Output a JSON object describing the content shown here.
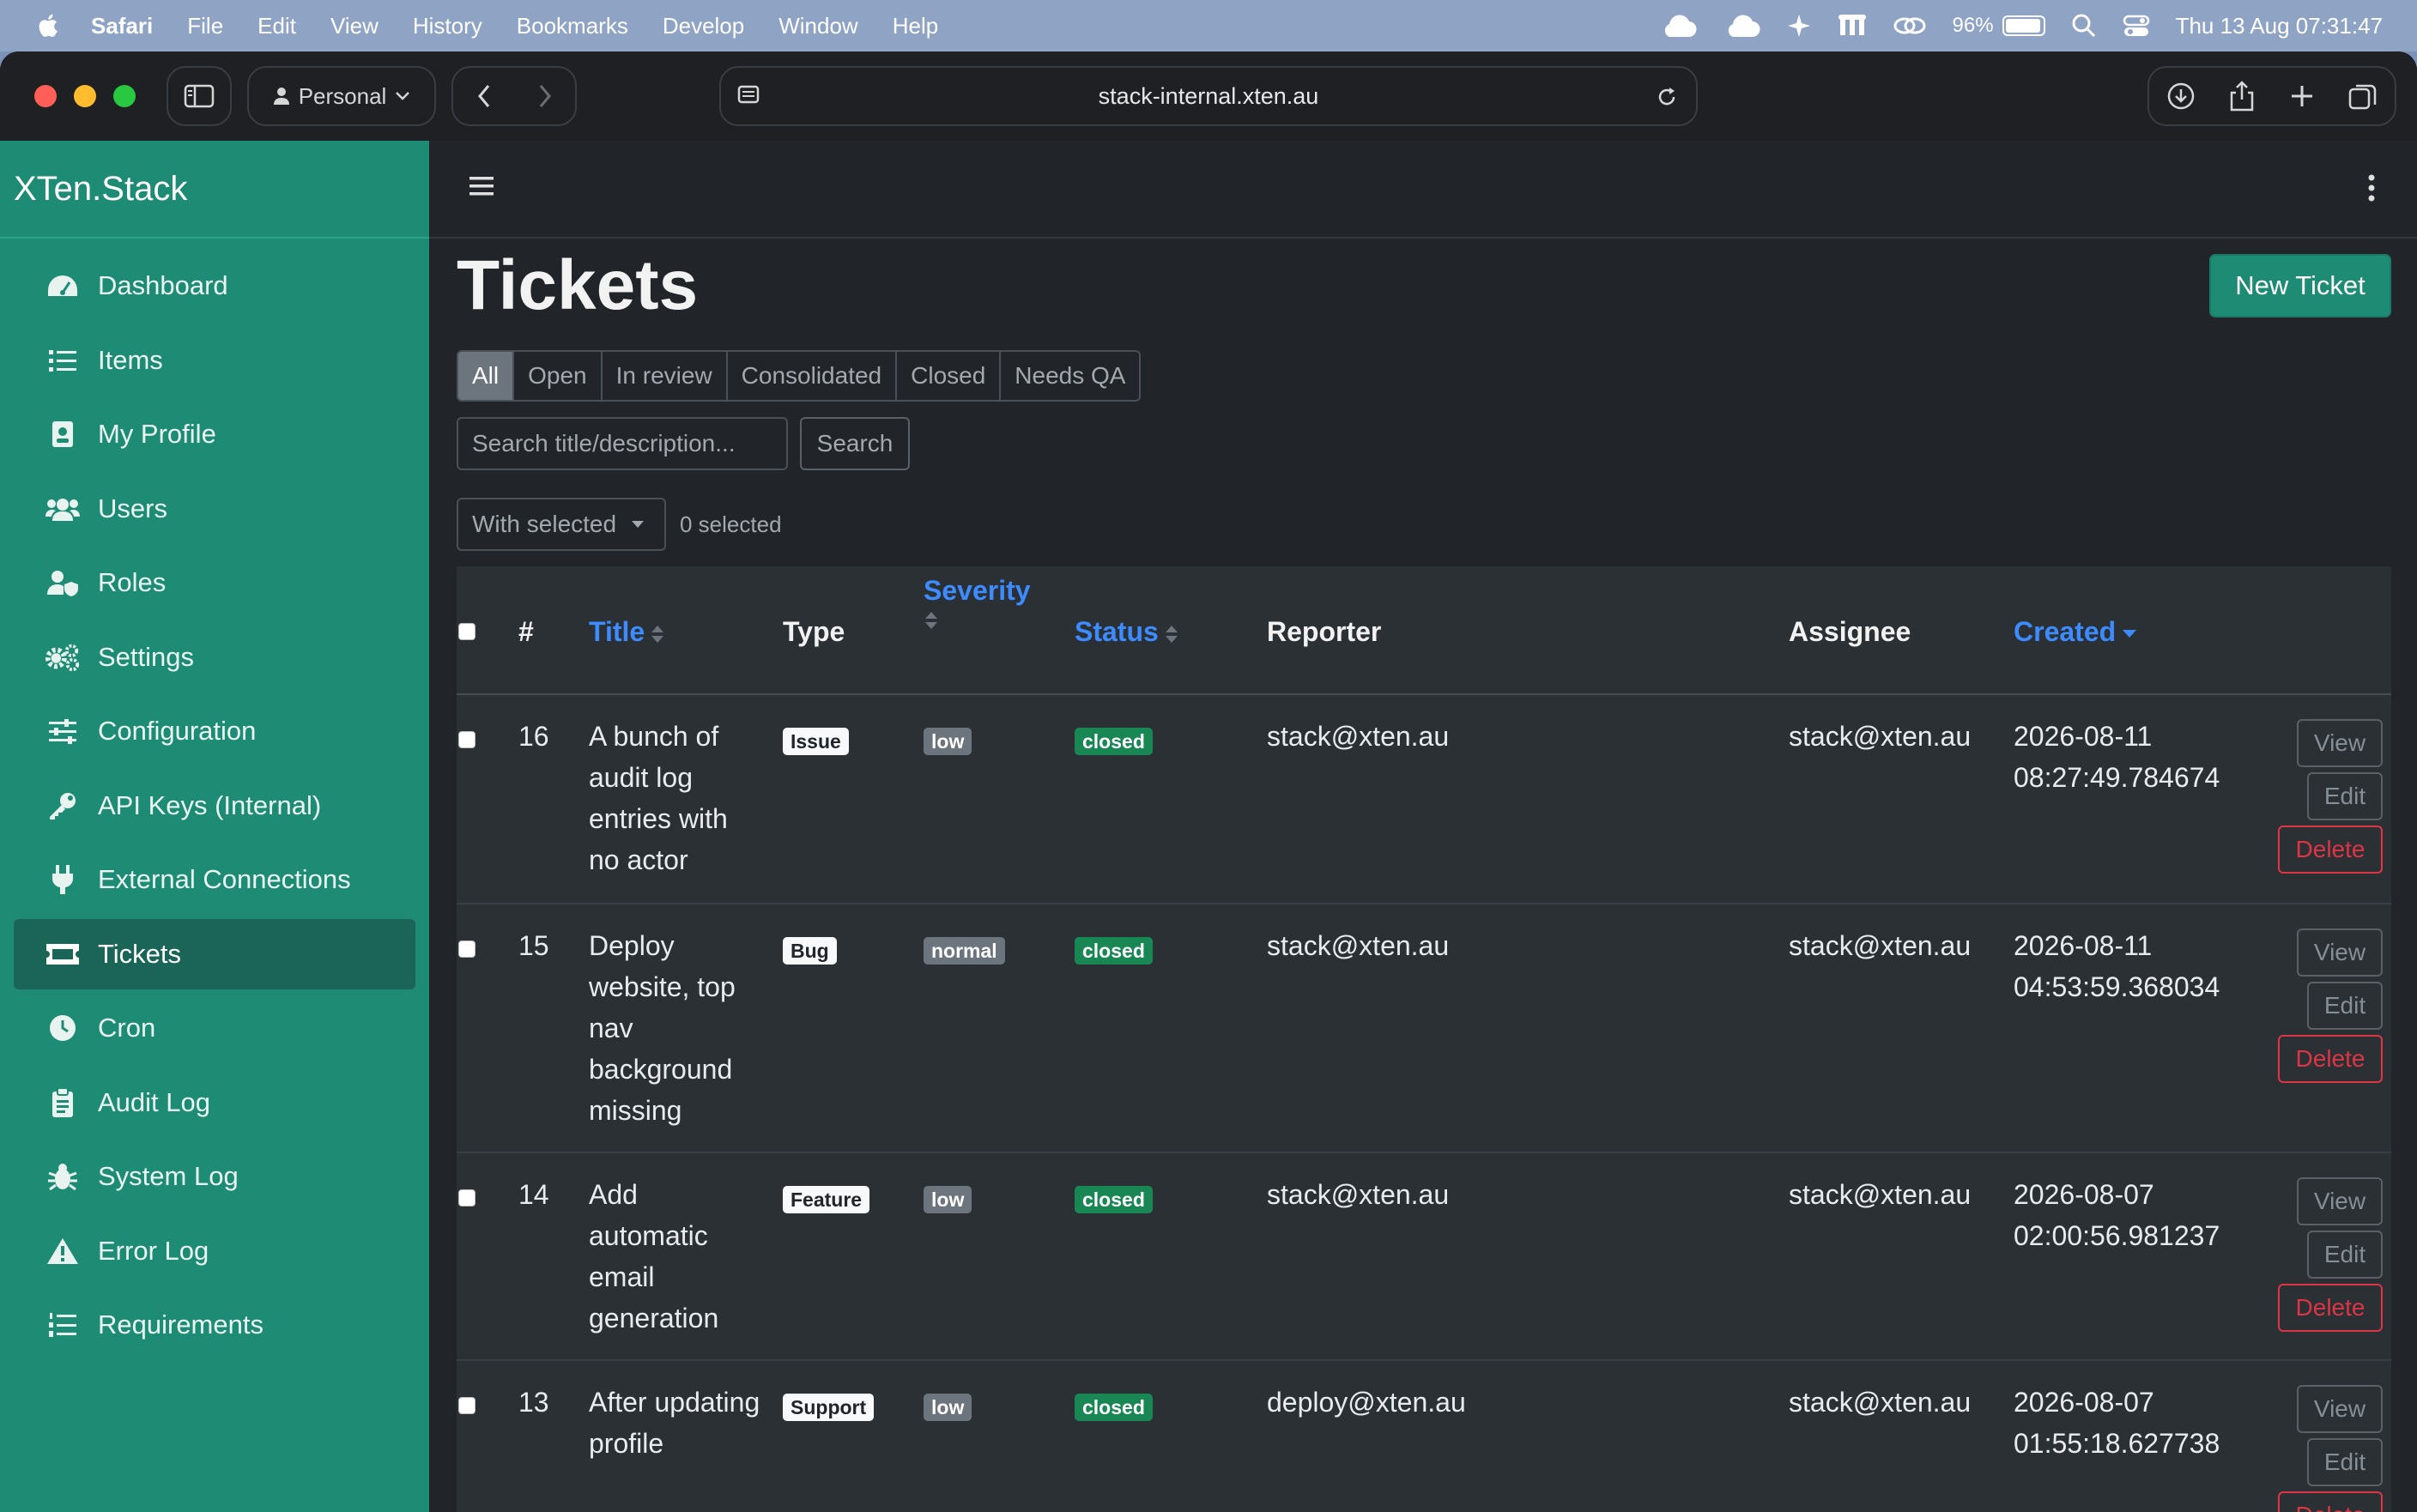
{
  "menubar": {
    "app_name": "Safari",
    "menus": [
      "File",
      "Edit",
      "View",
      "History",
      "Bookmarks",
      "Develop",
      "Window",
      "Help"
    ],
    "battery": "96%",
    "datetime": "Thu 13 Aug  07:31:47"
  },
  "browser": {
    "profile": "Personal",
    "url": "stack-internal.xten.au"
  },
  "sidebar": {
    "brand": "XTen.Stack",
    "items": [
      {
        "label": "Dashboard",
        "icon": "dashboard-icon"
      },
      {
        "label": "Items",
        "icon": "list-icon"
      },
      {
        "label": "My Profile",
        "icon": "id-badge-icon"
      },
      {
        "label": "Users",
        "icon": "users-icon"
      },
      {
        "label": "Roles",
        "icon": "user-shield-icon"
      },
      {
        "label": "Settings",
        "icon": "gears-icon"
      },
      {
        "label": "Configuration",
        "icon": "sliders-icon"
      },
      {
        "label": "API Keys (Internal)",
        "icon": "key-icon"
      },
      {
        "label": "External Connections",
        "icon": "plug-icon"
      },
      {
        "label": "Tickets",
        "icon": "ticket-icon",
        "active": true
      },
      {
        "label": "Cron",
        "icon": "clock-icon"
      },
      {
        "label": "Audit Log",
        "icon": "clipboard-icon"
      },
      {
        "label": "System Log",
        "icon": "bug-icon"
      },
      {
        "label": "Error Log",
        "icon": "warning-icon"
      },
      {
        "label": "Requirements",
        "icon": "list-ol-icon"
      }
    ]
  },
  "page": {
    "title": "Tickets",
    "new_ticket_label": "New Ticket",
    "filters": [
      "All",
      "Open",
      "In review",
      "Consolidated",
      "Closed",
      "Needs QA"
    ],
    "active_filter": "All",
    "search_placeholder": "Search title/description...",
    "search_label": "Search",
    "with_selected_label": "With selected",
    "selected_count": "0 selected"
  },
  "table": {
    "columns": {
      "id": "#",
      "title": "Title",
      "type": "Type",
      "severity": "Severity",
      "status": "Status",
      "reporter": "Reporter",
      "assignee": "Assignee",
      "created": "Created"
    },
    "actions": {
      "view": "View",
      "edit": "Edit",
      "delete": "Delete"
    },
    "rows": [
      {
        "id": "16",
        "title": "A bunch of audit log entries with no actor",
        "type": "Issue",
        "severity": "low",
        "status": "closed",
        "reporter": "stack@xten.au",
        "assignee": "stack@xten.au",
        "created": "2026-08-11 08:27:49.784674"
      },
      {
        "id": "15",
        "title": "Deploy website, top nav background missing",
        "type": "Bug",
        "severity": "normal",
        "status": "closed",
        "reporter": "stack@xten.au",
        "assignee": "stack@xten.au",
        "created": "2026-08-11 04:53:59.368034"
      },
      {
        "id": "14",
        "title": "Add automatic email generation",
        "type": "Feature",
        "severity": "low",
        "status": "closed",
        "reporter": "stack@xten.au",
        "assignee": "stack@xten.au",
        "created": "2026-08-07 02:00:56.981237"
      },
      {
        "id": "13",
        "title": "After updating profile",
        "type": "Support",
        "severity": "low",
        "status": "closed",
        "reporter": "deploy@xten.au",
        "assignee": "stack@xten.au",
        "created": "2026-08-07 01:55:18.627738"
      }
    ]
  }
}
